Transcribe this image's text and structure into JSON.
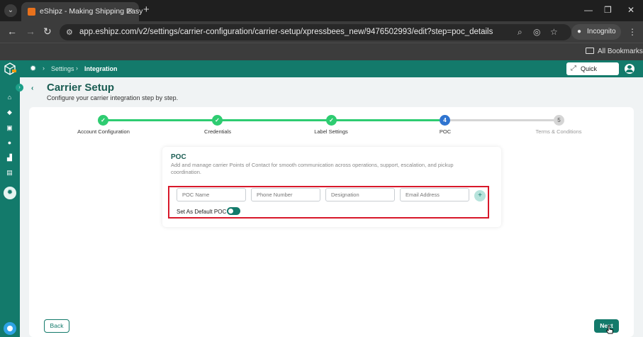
{
  "browser": {
    "tab_title": "eShipz - Making Shipping Easy",
    "url": "app.eshipz.com/v2/settings/carrier-configuration/carrier-setup/xpressbees_new/9476502993/edit?step=poc_details",
    "incognito_label": "Incognito",
    "bookmarks_label": "All Bookmarks"
  },
  "header": {
    "breadcrumb": [
      "Settings",
      "Integration"
    ],
    "quick_actions_label": "Quick Actions"
  },
  "page": {
    "title": "Carrier Setup",
    "subtitle": "Configure your carrier integration step by step."
  },
  "stepper": {
    "steps": [
      {
        "number": "1",
        "label": "Account Configuration",
        "state": "done"
      },
      {
        "number": "2",
        "label": "Credentials",
        "state": "done"
      },
      {
        "number": "3",
        "label": "Label Settings",
        "state": "done"
      },
      {
        "number": "4",
        "label": "POC",
        "state": "current"
      },
      {
        "number": "5",
        "label": "Terms & Conditions",
        "state": "todo"
      }
    ]
  },
  "poc": {
    "title": "POC",
    "description": "Add and manage carrier Points of Contact for smooth communication across operations, support, escalation, and pickup coordination.",
    "fields": {
      "name_placeholder": "POC Name",
      "phone_placeholder": "Phone Number",
      "designation_placeholder": "Designation",
      "email_placeholder": "Email Address"
    },
    "add_label": "+",
    "default_label": "Set As Default POC"
  },
  "footer": {
    "back_label": "Back",
    "next_label": "Next"
  },
  "colors": {
    "brand": "#137a6b",
    "step_done": "#2ecc71",
    "step_current": "#2f74d0",
    "highlight": "#d8182a"
  }
}
